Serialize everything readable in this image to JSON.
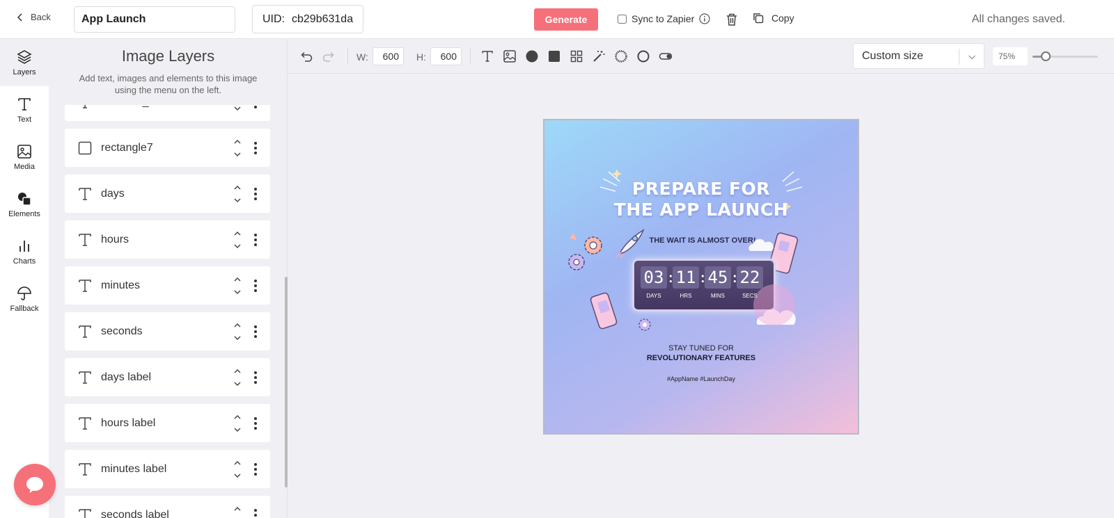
{
  "topbar": {
    "back_label": "Back",
    "name_value": "App Launch",
    "uid_label": "UID:",
    "uid_value": "cb29b631da",
    "generate_label": "Generate",
    "sync_label": "Sync to Zapier",
    "sync_checked": false,
    "copy_label": "Copy",
    "status": "All changes saved."
  },
  "rail": {
    "items": [
      {
        "label": "Layers",
        "icon": "layers-icon",
        "active": true
      },
      {
        "label": "Text",
        "icon": "text-icon"
      },
      {
        "label": "Media",
        "icon": "image-icon"
      },
      {
        "label": "Elements",
        "icon": "shapes-icon"
      },
      {
        "label": "Charts",
        "icon": "bar-chart-icon"
      },
      {
        "label": "Fallback",
        "icon": "umbrella-icon"
      }
    ]
  },
  "panel": {
    "title": "Image Layers",
    "subtitle": "Add text, images and elements to this image using the menu on the left.",
    "layers": [
      {
        "name": "discount_text",
        "type": "text"
      },
      {
        "name": "rectangle7",
        "type": "rectangle"
      },
      {
        "name": "days",
        "type": "text"
      },
      {
        "name": "hours",
        "type": "text"
      },
      {
        "name": "minutes",
        "type": "text"
      },
      {
        "name": "seconds",
        "type": "text"
      },
      {
        "name": "days label",
        "type": "text"
      },
      {
        "name": "hours label",
        "type": "text"
      },
      {
        "name": "minutes label",
        "type": "text"
      },
      {
        "name": "seconds label",
        "type": "text"
      }
    ]
  },
  "toolbar": {
    "width_label": "W:",
    "width_value": "600",
    "height_label": "H:",
    "height_value": "600",
    "size_preset": "Custom size",
    "zoom_label": "75%",
    "zoom_fraction": 0.2
  },
  "artboard": {
    "title_line1": "PREPARE FOR",
    "title_line2": "THE APP LAUNCH",
    "tagline": "THE WAIT IS ALMOST OVER!",
    "countdown": [
      {
        "value": "03",
        "label": "DAYS"
      },
      {
        "value": "11",
        "label": "HRS"
      },
      {
        "value": "45",
        "label": "MINS"
      },
      {
        "value": "22",
        "label": "SECS"
      }
    ],
    "stay_tuned": "STAY TUNED FOR",
    "features": "REVOLUTIONARY FEATURES",
    "hashtags": "#AppName #LaunchDay"
  },
  "colors": {
    "accent": "#f6707a",
    "panel_bg": "#f0f0f4"
  }
}
